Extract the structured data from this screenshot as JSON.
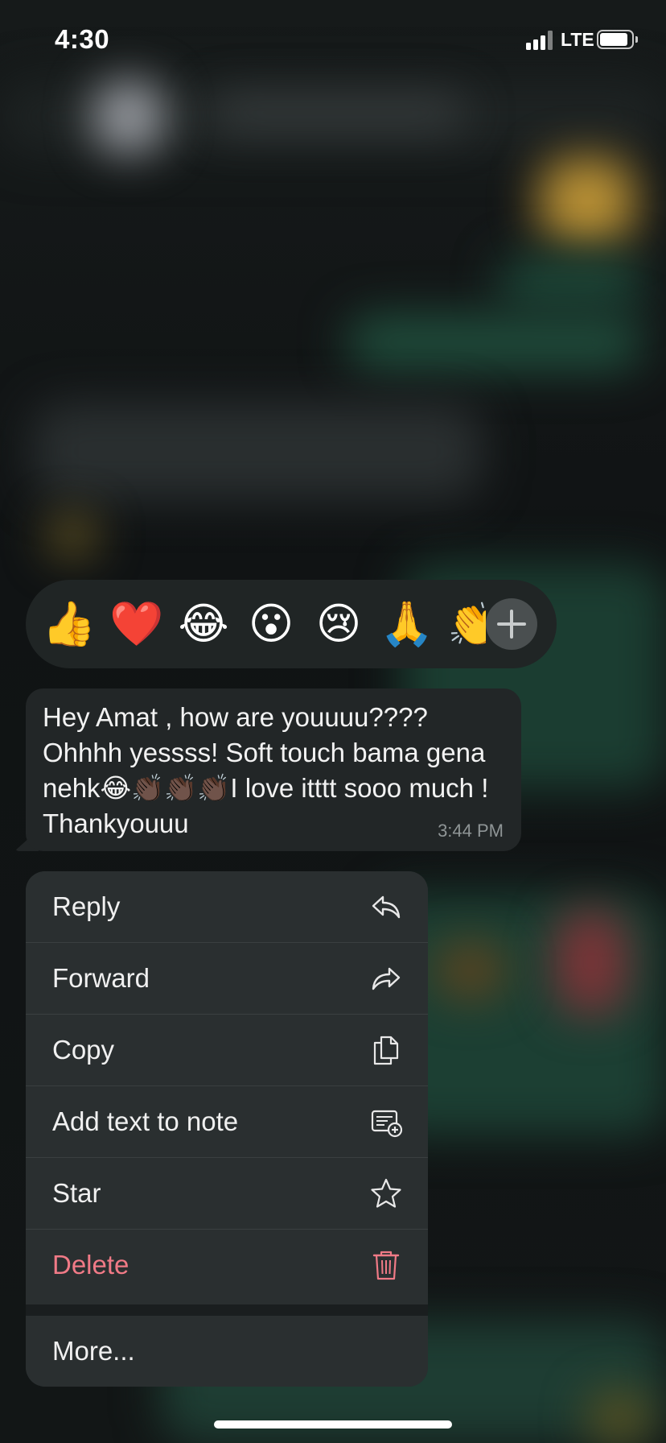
{
  "status_bar": {
    "time": "4:30",
    "network": "LTE",
    "battery_level": 0.9
  },
  "reactions": {
    "items": [
      {
        "emoji": "👍",
        "name": "thumbs-up"
      },
      {
        "emoji": "❤️",
        "name": "red-heart"
      },
      {
        "emoji": "😂",
        "name": "tears-of-joy"
      },
      {
        "emoji": "😮",
        "name": "open-mouth"
      },
      {
        "emoji": "😢",
        "name": "crying-face"
      },
      {
        "emoji": "🙏",
        "name": "folded-hands"
      },
      {
        "emoji": "👏",
        "name": "clapping-hands"
      }
    ],
    "add_icon": "plus-icon"
  },
  "message": {
    "text": "Hey Amat , how are youuuu???? Ohhhh yessss! Soft touch bama gena nehk😂👏🏿👏🏿👏🏿I love itttt sooo much ! Thankyouuu",
    "time": "3:44 PM"
  },
  "menu": {
    "items": [
      {
        "label": "Reply",
        "icon": "reply-icon"
      },
      {
        "label": "Forward",
        "icon": "forward-icon"
      },
      {
        "label": "Copy",
        "icon": "copy-icon"
      },
      {
        "label": "Add text to note",
        "icon": "add-note-icon"
      },
      {
        "label": "Star",
        "icon": "star-icon"
      },
      {
        "label": "Delete",
        "icon": "trash-icon"
      }
    ],
    "more_label": "More...",
    "colors": {
      "destructive": "#f07a86",
      "background": "#2a2f30"
    }
  }
}
